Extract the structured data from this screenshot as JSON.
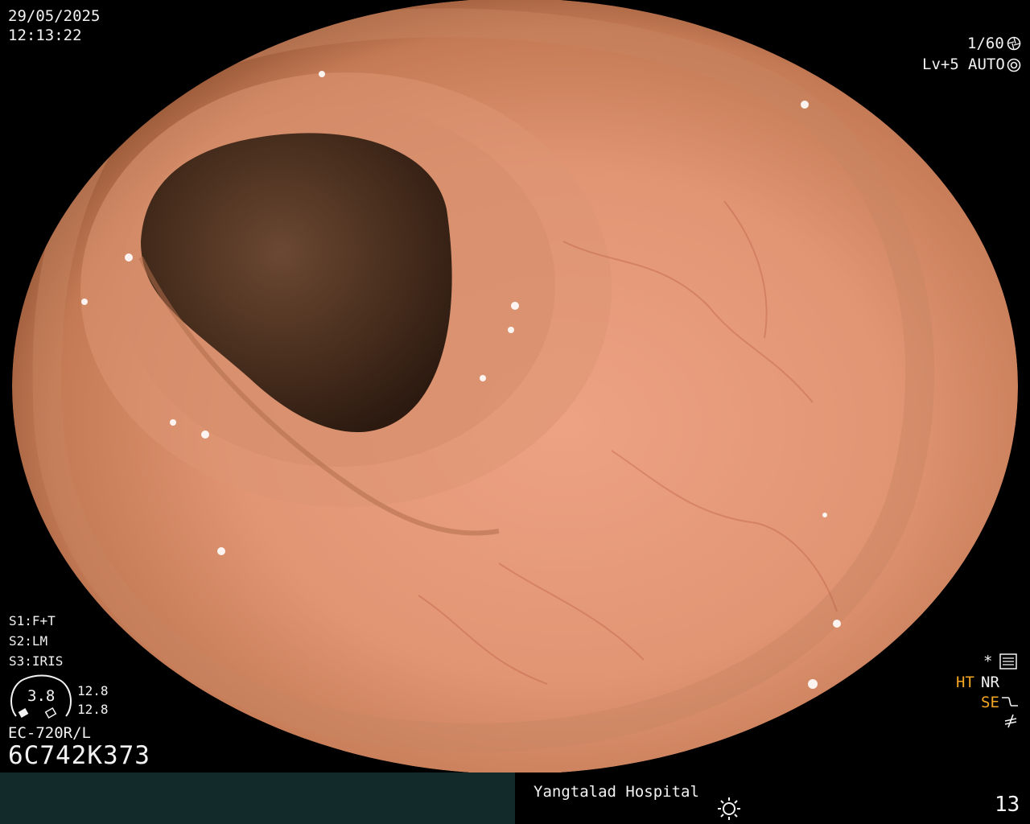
{
  "overlay": {
    "date": "29/05/2025",
    "time": "12:13:22",
    "shutter": "1/60",
    "level": "Lv+5",
    "mode": "AUTO",
    "s1": "S1:F+T",
    "s2": "S2:LM",
    "s3": "S3:IRIS",
    "gauge_value": "3.8",
    "gauge_right_1": "12.8",
    "gauge_right_2": "12.8",
    "scope_model": "EC-720R/L",
    "serial": "6C742K373",
    "flag_asterisk": "*",
    "flag_ht": "HT",
    "flag_nr": "NR",
    "flag_se": "SE"
  },
  "footer": {
    "hospital": "Yangtalad Hospital",
    "frame_number": "13"
  },
  "colors": {
    "mucosa": "#e59a78",
    "lumen": "#3a2416",
    "highlight_orange": "#f5a623",
    "footer_left": "#132a2a"
  },
  "icons": [
    "shutter-icon",
    "iris-icon",
    "settings-icon",
    "curve-icon",
    "signal-icon",
    "sun-icon"
  ]
}
